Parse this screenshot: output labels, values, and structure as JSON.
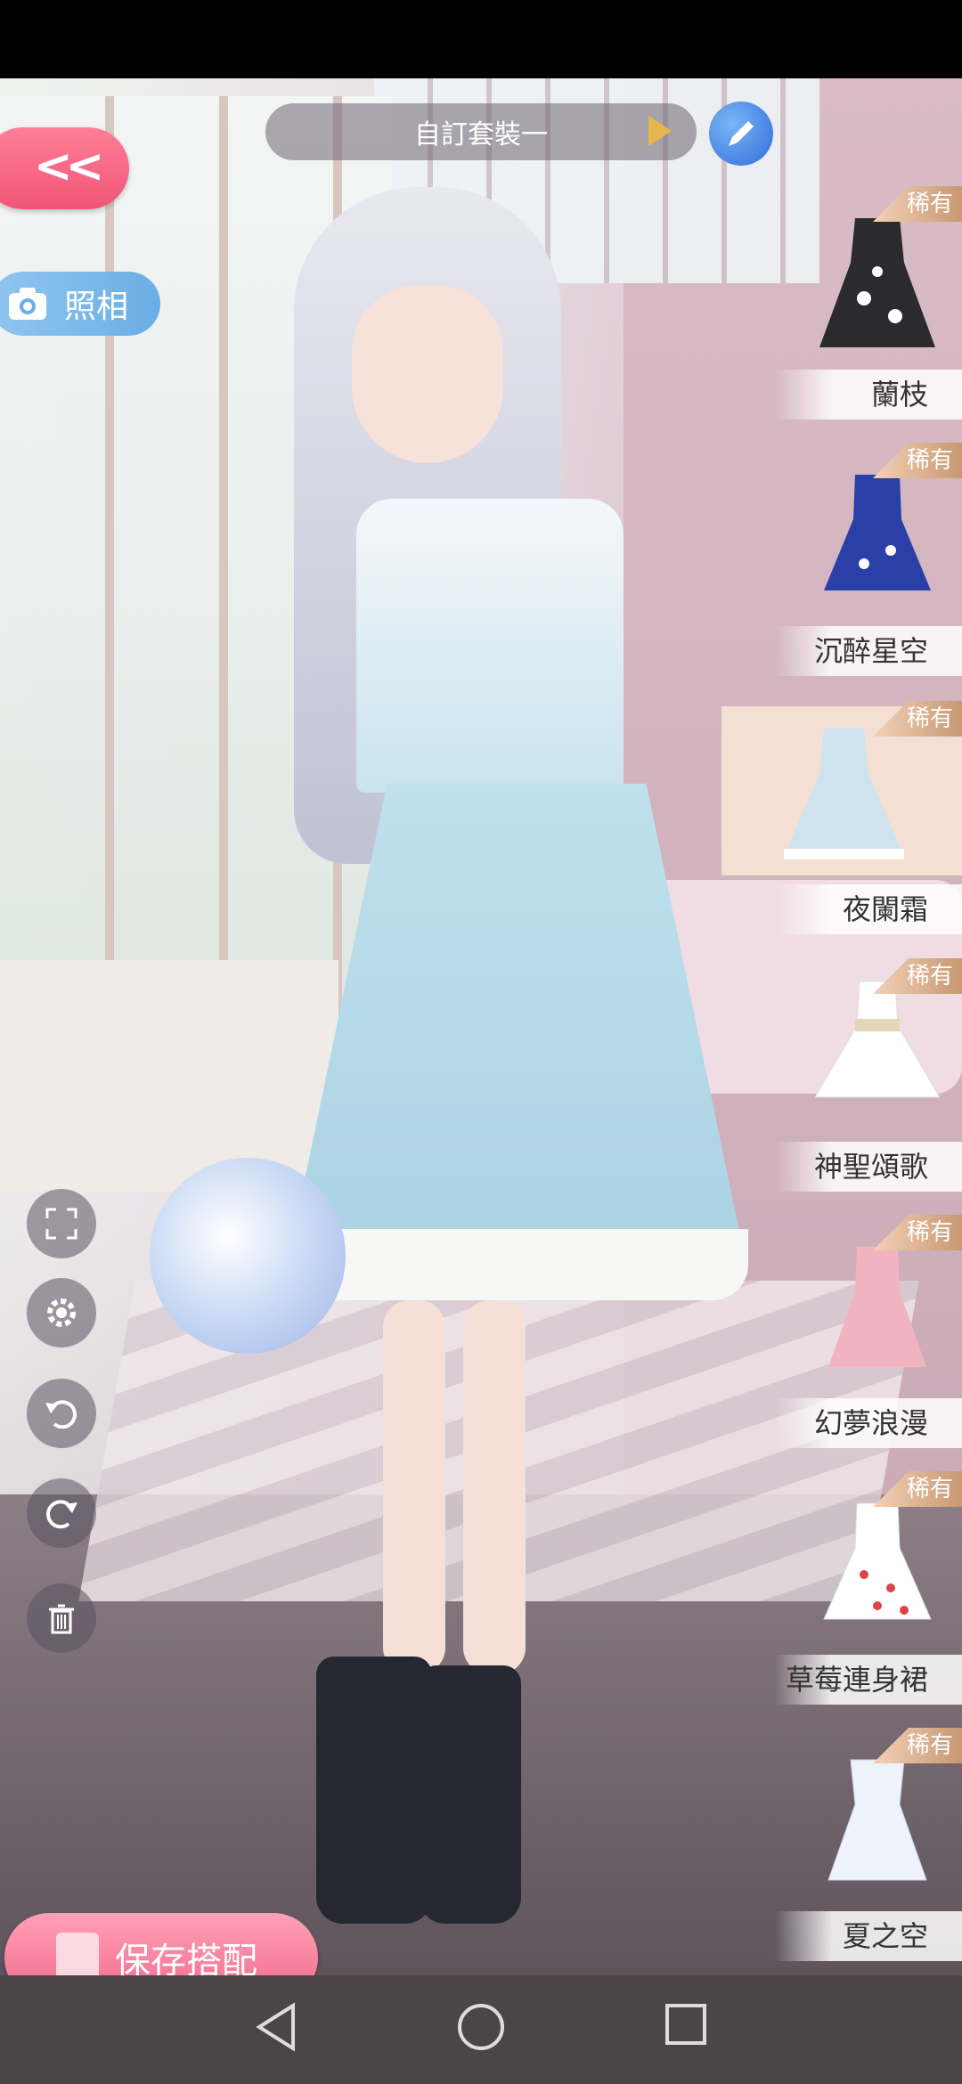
{
  "header": {
    "outfit_name": "自訂套裝一"
  },
  "buttons": {
    "photo_label": "照相",
    "save_label": "保存搭配"
  },
  "rare_badge": "稀有",
  "items": [
    {
      "name": "蘭枝",
      "rare": "稀有",
      "selected": false,
      "color": "#2b2b2f"
    },
    {
      "name": "沉醉星空",
      "rare": "稀有",
      "selected": false,
      "color": "#2a3fa8"
    },
    {
      "name": "夜闌霜",
      "rare": "稀有",
      "selected": true,
      "color": "#cfe3ee"
    },
    {
      "name": "神聖頌歌",
      "rare": "稀有",
      "selected": false,
      "color": "#ffffff"
    },
    {
      "name": "幻夢浪漫",
      "rare": "稀有",
      "selected": false,
      "color": "#f2b3c0"
    },
    {
      "name": "草莓連身裙",
      "rare": "稀有",
      "selected": false,
      "color": "#ffffff"
    },
    {
      "name": "夏之空",
      "rare": "稀有",
      "selected": false,
      "color": "#eef3fb"
    }
  ],
  "colors": {
    "accent_pink": "#f05577",
    "accent_blue": "#6aaee6",
    "rare_gold": "#c79872"
  }
}
